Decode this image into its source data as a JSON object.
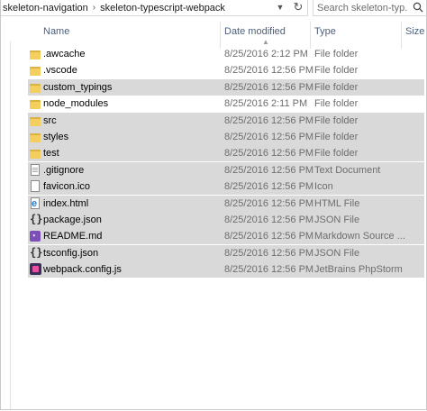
{
  "address_bar": {
    "crumbs": [
      "skeleton-navigation",
      "skeleton-typescript-webpack"
    ],
    "separator": "›",
    "dropdown_icon": "chevron-down-icon",
    "refresh_icon": "refresh-icon"
  },
  "search": {
    "placeholder": "Search skeleton-typ..."
  },
  "columns": {
    "name": "Name",
    "date": "Date modified",
    "type": "Type",
    "size": "Size"
  },
  "files": [
    {
      "name": ".awcache",
      "date": "8/25/2016 2:12 PM",
      "type": "File folder",
      "icon": "folder-icon",
      "selected": false
    },
    {
      "name": ".vscode",
      "date": "8/25/2016 12:56 PM",
      "type": "File folder",
      "icon": "folder-icon",
      "selected": false
    },
    {
      "name": "custom_typings",
      "date": "8/25/2016 12:56 PM",
      "type": "File folder",
      "icon": "folder-icon",
      "selected": true
    },
    {
      "name": "node_modules",
      "date": "8/25/2016 2:11 PM",
      "type": "File folder",
      "icon": "folder-icon",
      "selected": false
    },
    {
      "name": "src",
      "date": "8/25/2016 12:56 PM",
      "type": "File folder",
      "icon": "folder-icon",
      "selected": true
    },
    {
      "name": "styles",
      "date": "8/25/2016 12:56 PM",
      "type": "File folder",
      "icon": "folder-icon",
      "selected": true
    },
    {
      "name": "test",
      "date": "8/25/2016 12:56 PM",
      "type": "File folder",
      "icon": "folder-icon",
      "selected": true
    },
    {
      "name": ".gitignore",
      "date": "8/25/2016 12:56 PM",
      "type": "Text Document",
      "icon": "text-document-icon",
      "selected": true
    },
    {
      "name": "favicon.ico",
      "date": "8/25/2016 12:56 PM",
      "type": "Icon",
      "icon": "image-file-icon",
      "selected": true
    },
    {
      "name": "index.html",
      "date": "8/25/2016 12:56 PM",
      "type": "HTML File",
      "icon": "html-file-icon",
      "selected": true
    },
    {
      "name": "package.json",
      "date": "8/25/2016 12:56 PM",
      "type": "JSON File",
      "icon": "json-file-icon",
      "selected": true
    },
    {
      "name": "README.md",
      "date": "8/25/2016 12:56 PM",
      "type": "Markdown Source ...",
      "icon": "markdown-file-icon",
      "selected": true
    },
    {
      "name": "tsconfig.json",
      "date": "8/25/2016 12:56 PM",
      "type": "JSON File",
      "icon": "json-file-icon",
      "selected": true
    },
    {
      "name": "webpack.config.js",
      "date": "8/25/2016 12:56 PM",
      "type": "JetBrains PhpStorm",
      "icon": "phpstorm-file-icon",
      "selected": true
    }
  ],
  "colors": {
    "selection": "#d9d9d9",
    "folder": "#f4cf5d",
    "header_text": "#4c607a"
  }
}
